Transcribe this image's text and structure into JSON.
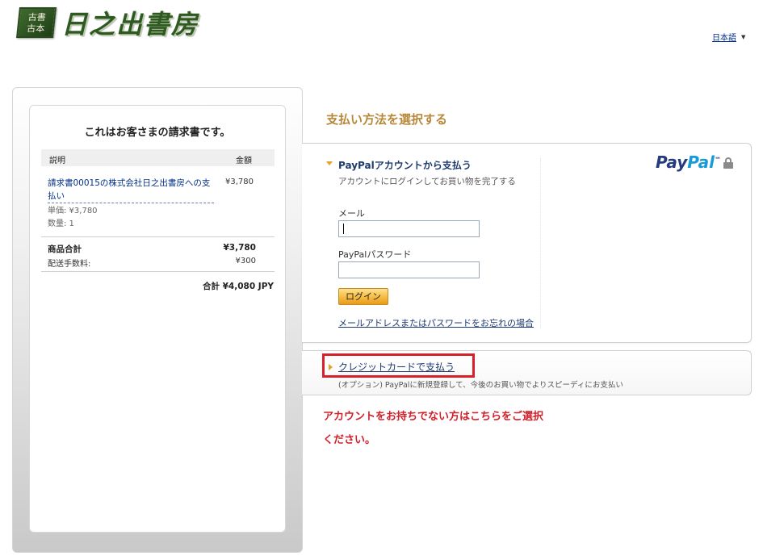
{
  "header": {
    "logo_badge_line1": "古書",
    "logo_badge_line2": "古本",
    "logo_text": "日之出書房",
    "language": "日本語"
  },
  "invoice": {
    "title": "これはお客さまの請求書です。",
    "col_description": "説明",
    "col_amount": "金額",
    "item_name": "請求書00015の株式会社日之出書房への支払い",
    "item_amount": "¥3,780",
    "item_unit_price": "単価: ¥3,780",
    "item_quantity": "数量: 1",
    "subtotal_label": "商品合計",
    "subtotal_value": "¥3,780",
    "shipping_label": "配送手数料:",
    "shipping_value": "¥300",
    "total": "合計 ¥4,080 JPY"
  },
  "payment": {
    "section_title": "支払い方法を選択する",
    "paypal_heading": "PayPalアカウントから支払う",
    "paypal_sub": "アカウントにログインしてお買い物を完了する",
    "email_label": "メール",
    "email_value": "",
    "password_label": "PayPalパスワード",
    "password_value": "",
    "login_label": "ログイン",
    "forgot_link": "メールアドレスまたはパスワードをお忘れの場合",
    "logo_pay": "Pay",
    "logo_pal": "Pal",
    "logo_tm": "™",
    "card_link": "クレジットカードで支払う",
    "card_sub": "(オプション) PayPalに新規登録して、今後のお買い物でよりスピーディにお支払い"
  },
  "note": {
    "line1": "アカウントをお持ちでない方はこちらをご選択",
    "line2": "ください。"
  },
  "colors": {
    "section_title": "#b7883a",
    "link": "#003087",
    "highlight_border": "#d8202a",
    "note_text": "#d0202a",
    "login_button": "#f5b73b"
  }
}
